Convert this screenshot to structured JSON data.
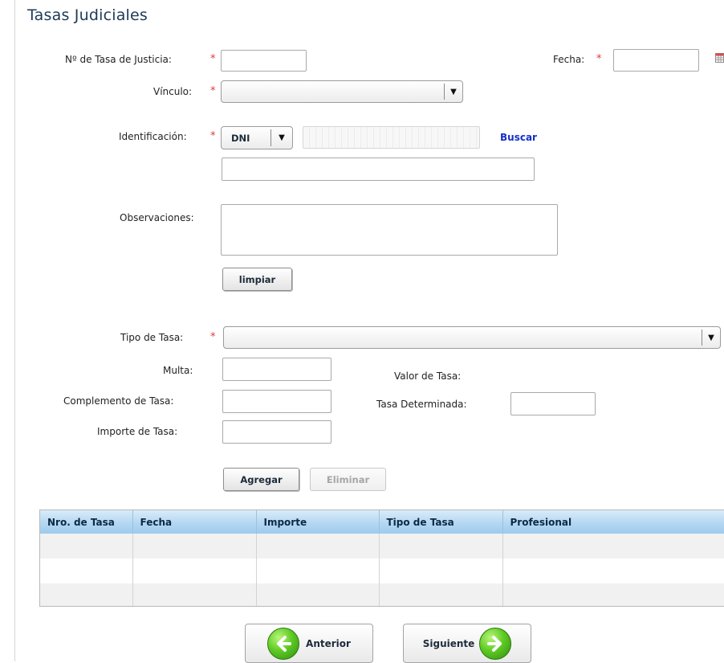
{
  "page": {
    "title": "Tasas Judiciales"
  },
  "form": {
    "nro_tasa_label": "Nº de Tasa de Justicia:",
    "fecha_label": "Fecha:",
    "vinculo_label": "Vínculo:",
    "identificacion_label": "Identificación:",
    "doc_type_value": "DNI",
    "buscar_link": "Buscar",
    "observaciones_label": "Observaciones:",
    "limpiar_button": "limpiar",
    "tipo_tasa_label": "Tipo de Tasa:",
    "multa_label": "Multa:",
    "valor_tasa_label": "Valor de Tasa:",
    "complemento_label": "Complemento de Tasa:",
    "tasa_determinada_label": "Tasa Determinada:",
    "importe_label": "Importe de Tasa:",
    "agregar_button": "Agregar",
    "eliminar_button": "Eliminar",
    "required_mark": "*"
  },
  "table": {
    "columns": [
      "Nro. de Tasa",
      "Fecha",
      "Importe",
      "Tipo de Tasa",
      "Profesional"
    ],
    "rows": [
      [
        "",
        "",
        "",
        "",
        ""
      ],
      [
        "",
        "",
        "",
        "",
        ""
      ],
      [
        "",
        "",
        "",
        "",
        ""
      ]
    ]
  },
  "nav": {
    "anterior": "Anterior",
    "siguiente": "Siguiente"
  },
  "icons": {
    "calendar": "calendar-icon",
    "dropdown": "chevron-down-icon",
    "back": "arrow-left-icon",
    "forward": "arrow-right-icon"
  },
  "colors": {
    "title": "#1d3a57",
    "required": "#e03a3a",
    "link": "#1630c8",
    "grid_header": "#b7d9f2",
    "nav_circle": "#5fcb24"
  }
}
